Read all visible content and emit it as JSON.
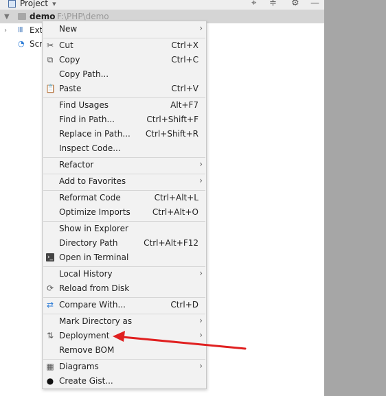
{
  "toolbar": {
    "project_label": "Project",
    "dropdown_glyph": "▾",
    "icons": [
      "target-icon",
      "collapse-icon",
      "gear-icon",
      "minimize-icon"
    ]
  },
  "tree": {
    "root_name": "demo",
    "root_path": "F:\\PHP\\demo",
    "items": [
      {
        "label": "Ext"
      },
      {
        "label": "Scr"
      }
    ]
  },
  "menu": {
    "items": [
      {
        "id": "new",
        "label": "New",
        "shortcut": "",
        "submenu": true,
        "icon": ""
      },
      {
        "id": "cut",
        "label": "Cut",
        "shortcut": "Ctrl+X",
        "submenu": false,
        "icon": "scissors-icon"
      },
      {
        "id": "copy",
        "label": "Copy",
        "shortcut": "Ctrl+C",
        "submenu": false,
        "icon": "copy-icon"
      },
      {
        "id": "copy-path",
        "label": "Copy Path...",
        "shortcut": "",
        "submenu": false,
        "icon": ""
      },
      {
        "id": "paste",
        "label": "Paste",
        "shortcut": "Ctrl+V",
        "submenu": false,
        "icon": "clipboard-icon"
      },
      {
        "id": "find-usages",
        "label": "Find Usages",
        "shortcut": "Alt+F7",
        "submenu": false,
        "icon": ""
      },
      {
        "id": "find-in-path",
        "label": "Find in Path...",
        "shortcut": "Ctrl+Shift+F",
        "submenu": false,
        "icon": ""
      },
      {
        "id": "replace-in-path",
        "label": "Replace in Path...",
        "shortcut": "Ctrl+Shift+R",
        "submenu": false,
        "icon": ""
      },
      {
        "id": "inspect-code",
        "label": "Inspect Code...",
        "shortcut": "",
        "submenu": false,
        "icon": ""
      },
      {
        "id": "refactor",
        "label": "Refactor",
        "shortcut": "",
        "submenu": true,
        "icon": ""
      },
      {
        "id": "add-to-favorites",
        "label": "Add to Favorites",
        "shortcut": "",
        "submenu": true,
        "icon": ""
      },
      {
        "id": "reformat-code",
        "label": "Reformat Code",
        "shortcut": "Ctrl+Alt+L",
        "submenu": false,
        "icon": ""
      },
      {
        "id": "optimize-imports",
        "label": "Optimize Imports",
        "shortcut": "Ctrl+Alt+O",
        "submenu": false,
        "icon": ""
      },
      {
        "id": "show-in-explorer",
        "label": "Show in Explorer",
        "shortcut": "",
        "submenu": false,
        "icon": ""
      },
      {
        "id": "directory-path",
        "label": "Directory Path",
        "shortcut": "Ctrl+Alt+F12",
        "submenu": false,
        "icon": ""
      },
      {
        "id": "open-in-terminal",
        "label": "Open in Terminal",
        "shortcut": "",
        "submenu": false,
        "icon": "terminal-icon"
      },
      {
        "id": "local-history",
        "label": "Local History",
        "shortcut": "",
        "submenu": true,
        "icon": ""
      },
      {
        "id": "reload-from-disk",
        "label": "Reload from Disk",
        "shortcut": "",
        "submenu": false,
        "icon": "reload-icon"
      },
      {
        "id": "compare-with",
        "label": "Compare With...",
        "shortcut": "Ctrl+D",
        "submenu": false,
        "icon": "compare-icon"
      },
      {
        "id": "mark-directory-as",
        "label": "Mark Directory as",
        "shortcut": "",
        "submenu": true,
        "icon": ""
      },
      {
        "id": "deployment",
        "label": "Deployment",
        "shortcut": "",
        "submenu": true,
        "icon": "deployment-icon"
      },
      {
        "id": "remove-bom",
        "label": "Remove BOM",
        "shortcut": "",
        "submenu": false,
        "icon": ""
      },
      {
        "id": "diagrams",
        "label": "Diagrams",
        "shortcut": "",
        "submenu": true,
        "icon": "diagram-icon"
      },
      {
        "id": "create-gist",
        "label": "Create Gist...",
        "shortcut": "",
        "submenu": false,
        "icon": "github-icon"
      }
    ]
  },
  "annotation": {
    "color": "#e02020",
    "points_to": "deployment"
  },
  "colors": {
    "menu_bg": "#f2f2f2",
    "selection": "#d5d5d5",
    "side_panel": "#a6a6a6",
    "compare_icon": "#2b7bd6"
  }
}
